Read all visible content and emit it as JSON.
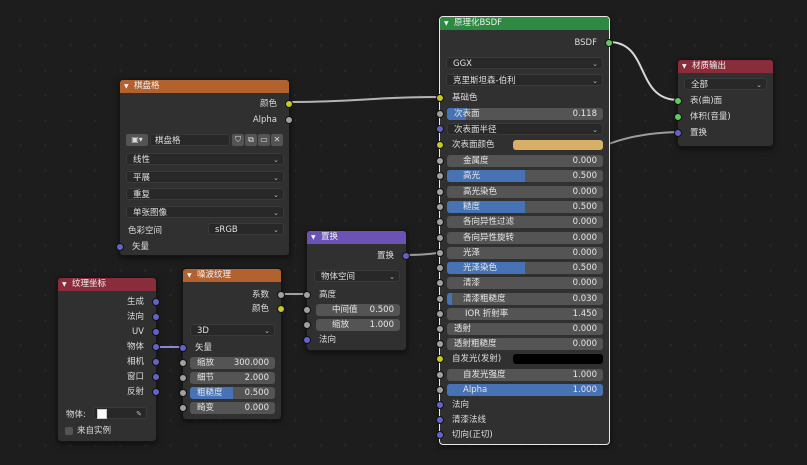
{
  "nodes": {
    "checker": {
      "title": "棋盘格",
      "out_color": "颜色",
      "out_alpha": "Alpha",
      "image_name": "棋盘格",
      "interpolation": "线性",
      "projection": "平展",
      "extension": "重复",
      "source": "单张图像",
      "color_space_label": "色彩空间",
      "color_space": "sRGB",
      "in_vector": "矢量"
    },
    "texcoord": {
      "title": "纹理坐标",
      "outputs": [
        "生成",
        "法向",
        "UV",
        "物体",
        "相机",
        "窗口",
        "反射"
      ],
      "object_label": "物体:",
      "from_instancer": "来自实例"
    },
    "noise": {
      "title": "噪波纹理",
      "out_fac": "系数",
      "out_color": "颜色",
      "dimensions": "3D",
      "in_vector": "矢量",
      "fields": [
        {
          "label": "缩放",
          "value": "300.000",
          "fill": 0
        },
        {
          "label": "细节",
          "value": "2.000",
          "fill": 0
        },
        {
          "label": "粗糙度",
          "value": "0.500",
          "fill": 0.5
        },
        {
          "label": "畸变",
          "value": "0.000",
          "fill": 0
        }
      ]
    },
    "displace": {
      "title": "置换",
      "out": "置换",
      "space": "物体空间",
      "in_height": "高度",
      "midlevel_label": "中间值",
      "midlevel": "0.500",
      "scale_label": "缩放",
      "scale": "1.000",
      "in_normal": "法向"
    },
    "bsdf": {
      "title": "原理化BSDF",
      "out": "BSDF",
      "distribution": "GGX",
      "subsurface_method": "克里斯坦森-伯利",
      "base_color": "基础色",
      "subsurface_label": "次表面",
      "subsurface": "0.118",
      "subsurface_radius": "次表面半径",
      "subsurface_color": "次表面颜色",
      "subsurface_color_hex": "#d7af67",
      "fields": [
        {
          "label": "金属度",
          "value": "0.000",
          "fill": 0
        },
        {
          "label": "高光",
          "value": "0.500",
          "fill": 0.5
        },
        {
          "label": "高光染色",
          "value": "0.000",
          "fill": 0
        },
        {
          "label": "糙度",
          "value": "0.500",
          "fill": 0.5
        },
        {
          "label": "各向异性过滤",
          "value": "0.000",
          "fill": 0
        },
        {
          "label": "各向异性旋转",
          "value": "0.000",
          "fill": 0
        },
        {
          "label": "光泽",
          "value": "0.000",
          "fill": 0
        },
        {
          "label": "光泽染色",
          "value": "0.500",
          "fill": 0.5
        },
        {
          "label": "清漆",
          "value": "0.000",
          "fill": 0
        },
        {
          "label": "清漆粗糙度",
          "value": "0.030",
          "fill": 0.03
        }
      ],
      "ior_label": "IOR 折射率",
      "ior": "1.450",
      "transmission_label": "透射",
      "transmission": "0.000",
      "transmission_rough_label": "透射粗糙度",
      "transmission_rough": "0.000",
      "emission": "自发光(发射)",
      "emission_strength_label": "自发光强度",
      "emission_strength": "1.000",
      "alpha_label": "Alpha",
      "alpha": "1.000",
      "normal": "法向",
      "clearcoat_normal": "清漆法线",
      "tangent": "切向(正切)"
    },
    "output": {
      "title": "材质输出",
      "target": "全部",
      "in_surface": "表(曲)面",
      "in_volume": "体积(音量)",
      "in_displacement": "置换"
    }
  }
}
